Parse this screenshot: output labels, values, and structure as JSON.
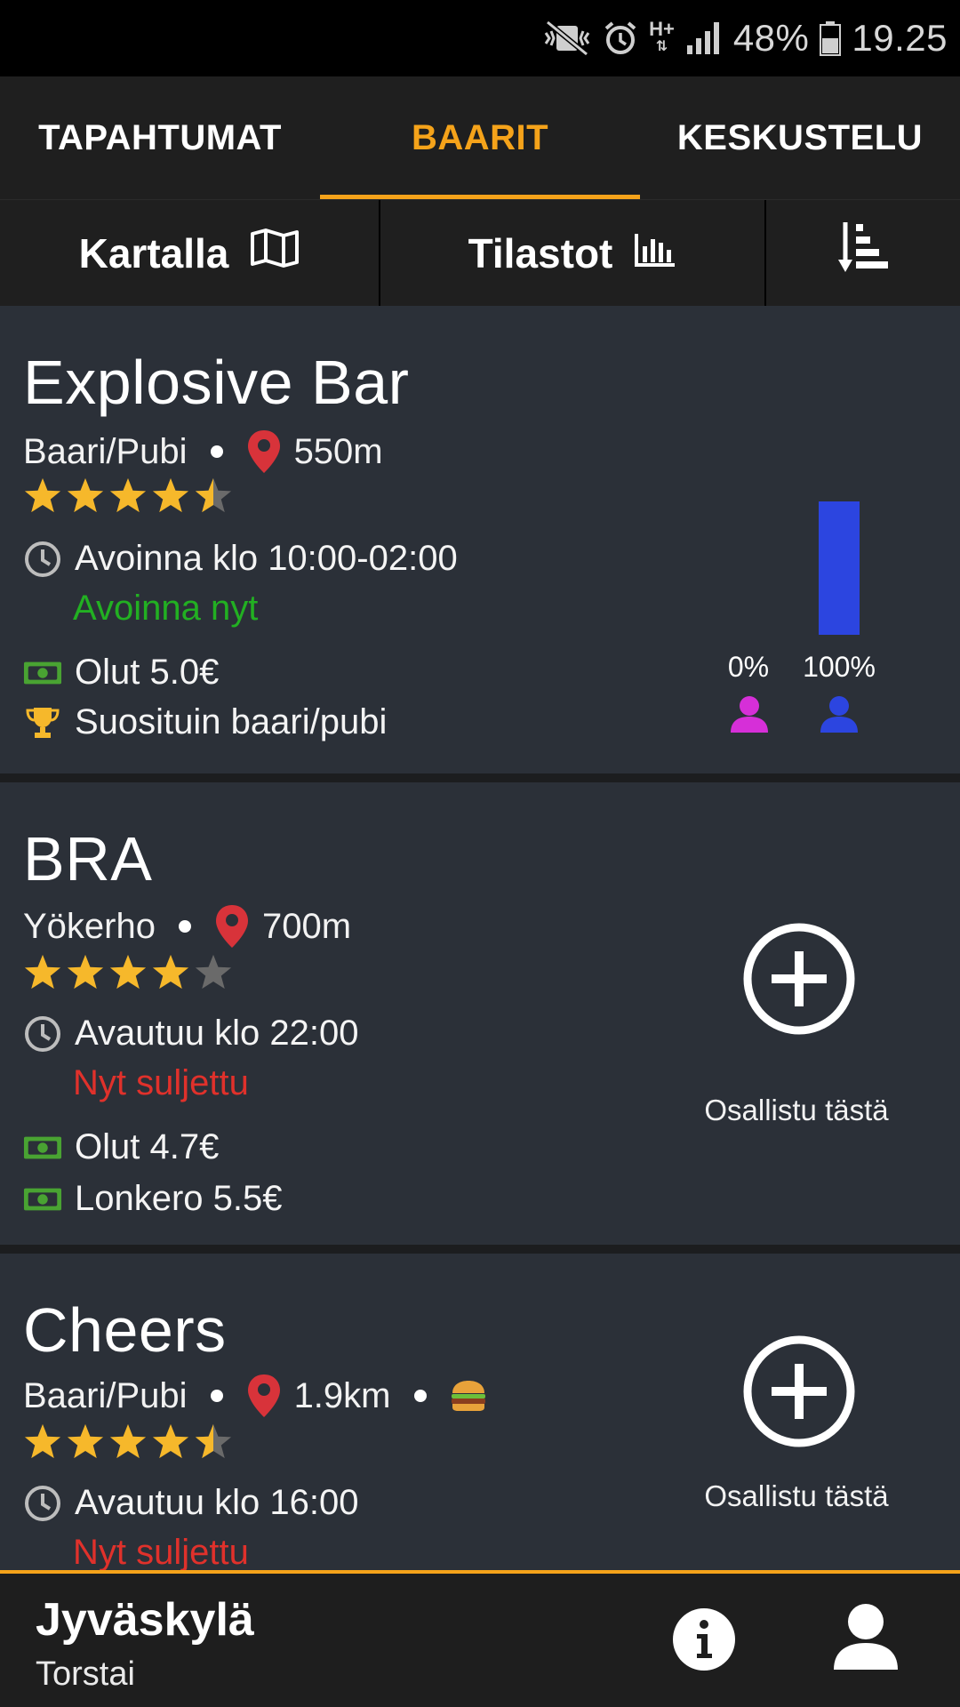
{
  "status_bar": {
    "battery": "48%",
    "time": "19.25",
    "network": "H+"
  },
  "tabs": [
    {
      "label": "TAPAHTUMAT",
      "active": false
    },
    {
      "label": "BAARIT",
      "active": true
    },
    {
      "label": "KESKUSTELU",
      "active": false
    }
  ],
  "toolbar": {
    "map_label": "Kartalla",
    "stats_label": "Tilastot"
  },
  "bars": [
    {
      "name": "Explosive Bar",
      "type": "Baari/Pubi",
      "distance": "550m",
      "rating": 4.5,
      "hours": "Avoinna klo 10:00-02:00",
      "status": "Avoinna nyt",
      "prices": [
        "Olut 5.0€"
      ],
      "award": "Suosituin baari/pubi",
      "gender": {
        "female_label": "0%",
        "male_label": "100%",
        "female": 0,
        "male": 1
      }
    },
    {
      "name": "BRA",
      "type": "Yökerho",
      "distance": "700m",
      "rating": 4,
      "hours": "Avautuu klo 22:00",
      "status": "Nyt suljettu",
      "prices": [
        "Olut 4.7€",
        "Lonkero 5.5€"
      ],
      "join_label": "Osallistu tästä"
    },
    {
      "name": "Cheers",
      "type": "Baari/Pubi",
      "distance": "1.9km",
      "rating": 4.5,
      "hours": "Avautuu klo 16:00",
      "status": "Nyt suljettu",
      "join_label": "Osallistu tästä"
    }
  ],
  "footer": {
    "city": "Jyväskylä",
    "day": "Torstai"
  },
  "colors": {
    "accent": "#f5a31a",
    "open": "#22b022",
    "closed": "#e0312b",
    "male": "#2c45e0",
    "female": "#d62fd8",
    "star": "#f6b82b"
  }
}
